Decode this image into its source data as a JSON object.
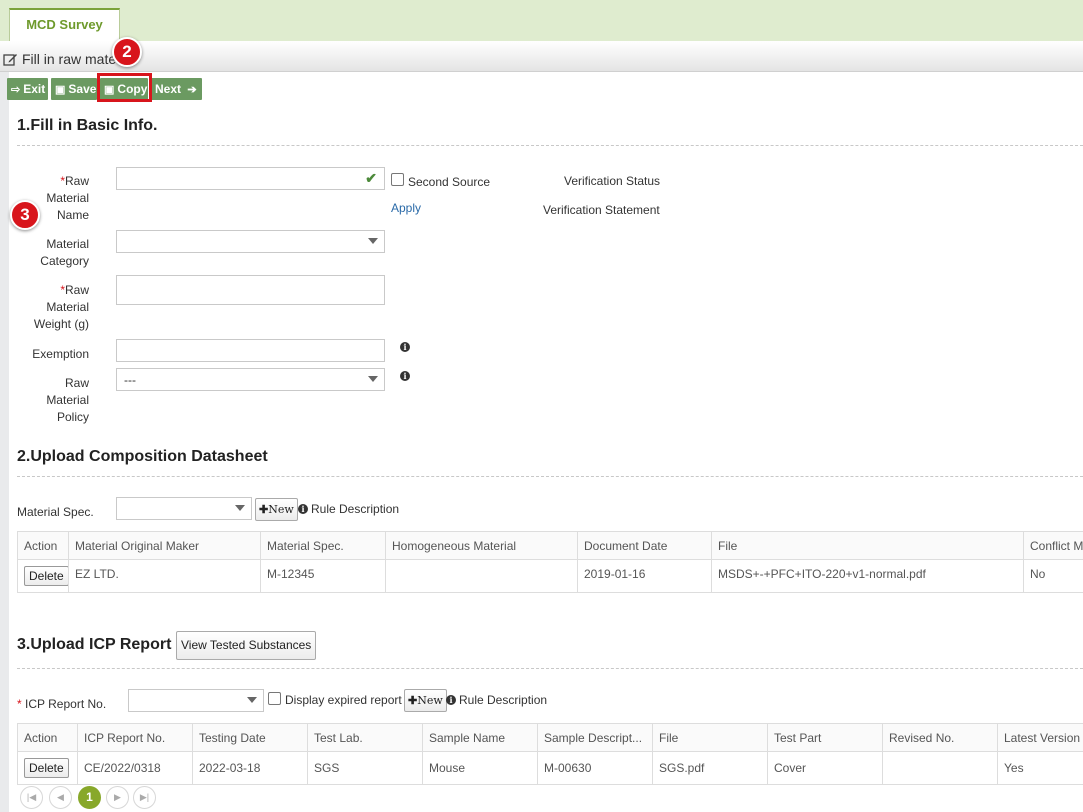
{
  "tabs": [
    {
      "label": "MCD Survey"
    }
  ],
  "page_header": {
    "title": "Fill in raw mate"
  },
  "annotations": {
    "marker_copy": "2",
    "marker_name": "3"
  },
  "toolbar": {
    "exit_label": "Exit",
    "save_label": "Save",
    "copy_label": "Copy",
    "next_label": "Next"
  },
  "section1": {
    "title": "1.Fill in Basic Info.",
    "raw_material_name_label": [
      "Raw",
      "Material",
      "Name"
    ],
    "second_source_label": "Second Source",
    "apply_label": "Apply",
    "verification_status_label": "Verification Status",
    "verification_statement_label": "Verification Statement",
    "material_category_label": [
      "Material",
      "Category"
    ],
    "raw_material_weight_label": [
      "Raw",
      "Material",
      "Weight (g)"
    ],
    "exemption_label": "Exemption",
    "raw_material_policy_label": [
      "Raw",
      "Material",
      "Policy"
    ],
    "raw_material_policy_value": "---"
  },
  "section2": {
    "title": "2.Upload Composition Datasheet",
    "material_spec_label": "Material Spec.",
    "new_label": "New",
    "rule_description_label": "Rule Description",
    "table": {
      "columns": [
        "Action",
        "Material Original Maker",
        "Material Spec.",
        "Homogeneous Material",
        "Document Date",
        "File",
        "Conflict Mi"
      ],
      "rows": [
        {
          "action": "Delete",
          "maker": "EZ LTD.",
          "spec": "M-12345",
          "homogeneous": "",
          "date": "2019-01-16",
          "file": "MSDS+-+PFC+ITO-220+v1-normal.pdf",
          "conflict": "No"
        }
      ]
    }
  },
  "section3": {
    "title": "3.Upload ICP Report",
    "view_tested_label": "View Tested Substances",
    "icp_report_no_label": "ICP Report No.",
    "display_expired_label": "Display expired report",
    "new_label": "New",
    "rule_description_label": "Rule Description",
    "table": {
      "columns": [
        "Action",
        "ICP Report No.",
        "Testing Date",
        "Test Lab.",
        "Sample Name",
        "Sample Descript...",
        "File",
        "Test Part",
        "Revised No.",
        "Latest Version"
      ],
      "rows": [
        {
          "action": "Delete",
          "report_no": "CE/2022/0318",
          "testing_date": "2022-03-18",
          "lab": "SGS",
          "sample_name": "Mouse",
          "sample_desc": "M-00630",
          "file": "SGS.pdf",
          "test_part": "Cover",
          "revised": "",
          "latest": "Yes"
        }
      ]
    },
    "pager": {
      "current_page": "1"
    }
  },
  "colors": {
    "accent_green": "#6b9a61",
    "tab_green": "#7ba33a",
    "marker_red": "#d8151c",
    "link_blue": "#2a6aa8"
  }
}
